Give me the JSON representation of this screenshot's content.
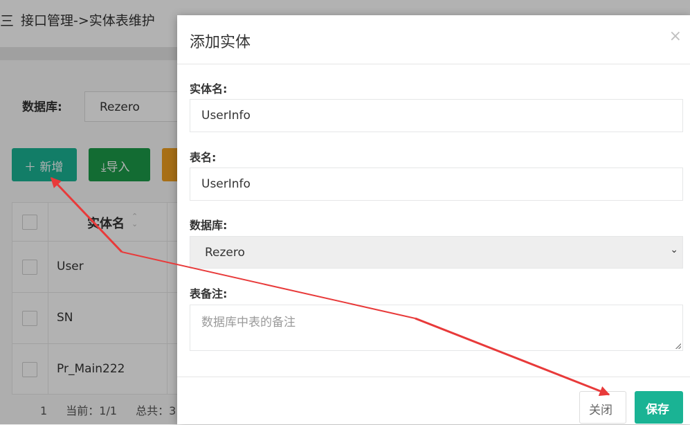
{
  "header": {
    "menu_icon": "三",
    "breadcrumb": "接口管理->实体表维护"
  },
  "filter": {
    "db_label": "数据库:",
    "db_value": "Rezero"
  },
  "toolbar": {
    "add_label": "＋ 新增",
    "import_label": "⤓导入"
  },
  "table": {
    "col_entity": "实体名",
    "rows": [
      {
        "entity": "User"
      },
      {
        "entity": "SN"
      },
      {
        "entity": "Pr_Main222"
      }
    ]
  },
  "pager": {
    "page": "1",
    "current": "当前：1/1",
    "total": "总共：3"
  },
  "modal": {
    "title": "添加实体",
    "close_symbol": "×",
    "entity_label": "实体名:",
    "entity_value": "UserInfo",
    "table_label": "表名:",
    "table_value": "UserInfo",
    "db_label": "数据库:",
    "db_value": "Rezero",
    "remark_label": "表备注:",
    "remark_placeholder": "数据库中表的备注",
    "close_label": "关闭",
    "save_label": "保存"
  },
  "colors": {
    "primary": "#1ab394",
    "import": "#1c9b4a",
    "arrow": "#e83a3a"
  }
}
